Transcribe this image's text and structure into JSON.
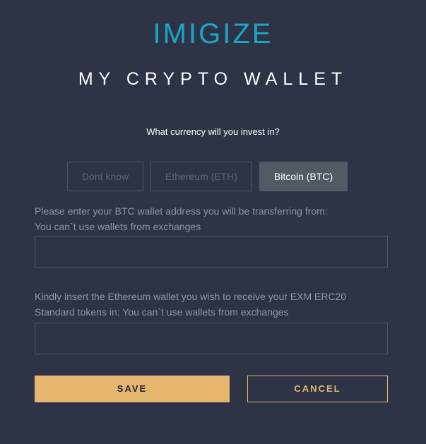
{
  "brand": {
    "logo_text": "IMIGIZE"
  },
  "header": {
    "title": "MY CRYPTO WALLET"
  },
  "currency": {
    "question": "What currency will you invest in?",
    "options": [
      {
        "label": "Dont know",
        "selected": false
      },
      {
        "label": "Ethereum (ETH)",
        "selected": false
      },
      {
        "label": "Bitcoin (BTC)",
        "selected": true
      }
    ]
  },
  "btc_wallet": {
    "label_line1": "Please enter your BTC wallet address you will be transferring from:",
    "label_line2": "You can`t use wallets from exchanges",
    "value": "",
    "placeholder": ""
  },
  "eth_wallet": {
    "label_line1": "Kindly insert the Ethereum wallet you wish to receive your EXM ERC20",
    "label_line2": "Standard tokens in: You can`t use wallets from exchanges",
    "value": "",
    "placeholder": ""
  },
  "actions": {
    "save_label": "SAVE",
    "cancel_label": "CANCEL"
  },
  "colors": {
    "background": "#2e3445",
    "brand": "#1aa6c9",
    "accent": "#e6b66e",
    "selected_option": "#535a66"
  }
}
